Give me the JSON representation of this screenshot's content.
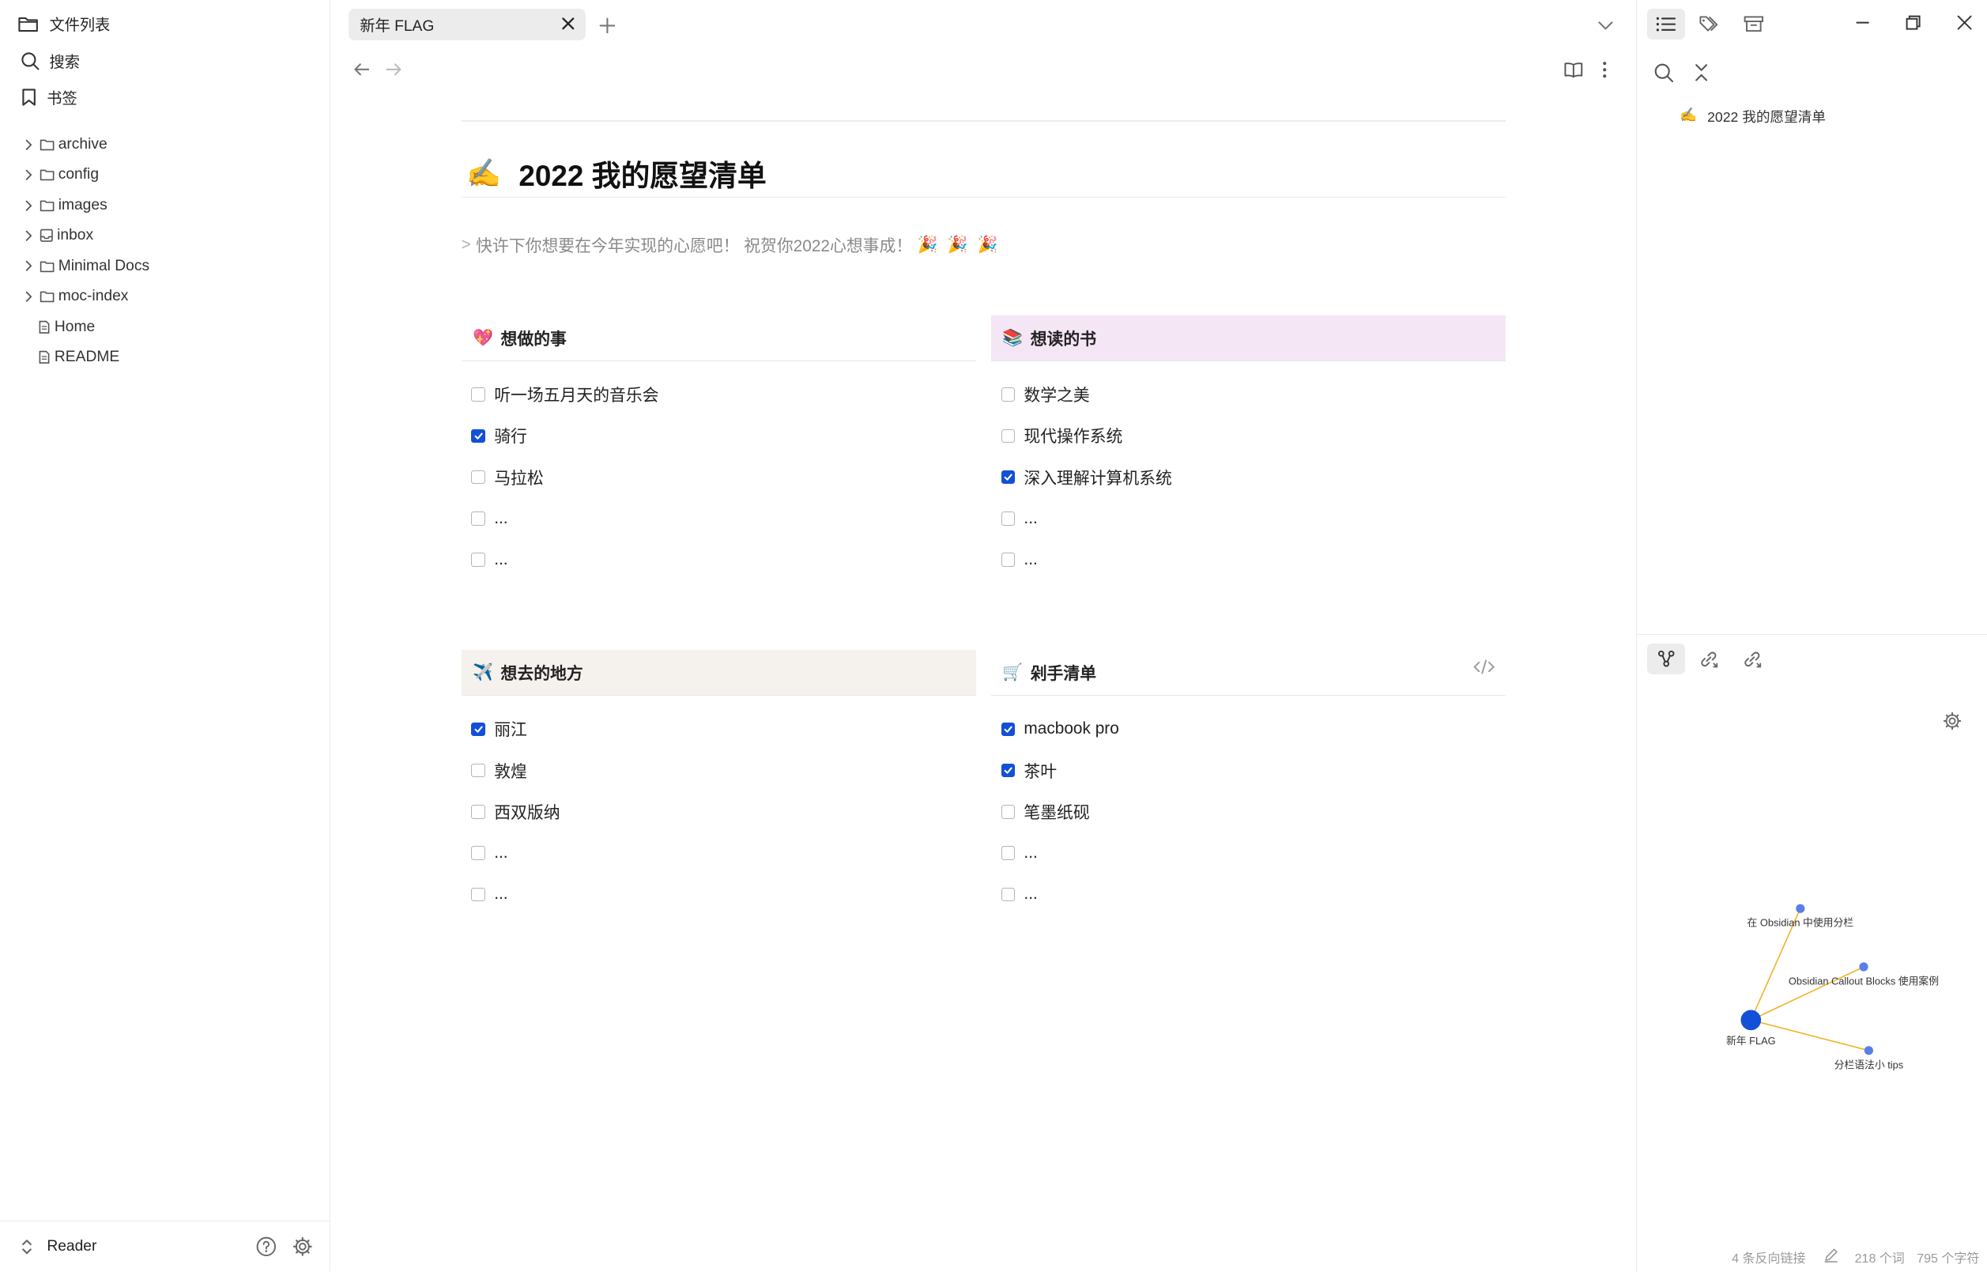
{
  "sidebar": {
    "file_list_label": "文件列表",
    "search_label": "搜索",
    "bookmarks_label": "书签",
    "folders": [
      {
        "name": "archive",
        "icon": "folder-icon"
      },
      {
        "name": "config",
        "icon": "folder-icon"
      },
      {
        "name": "images",
        "icon": "folder-icon"
      },
      {
        "name": "inbox",
        "icon": "inbox-icon"
      },
      {
        "name": "Minimal Docs",
        "icon": "folder-icon"
      },
      {
        "name": "moc-index",
        "icon": "folder-icon"
      }
    ],
    "files": [
      {
        "name": "Home"
      },
      {
        "name": "README"
      }
    ],
    "vault_name": "Reader"
  },
  "tabs": [
    {
      "label": "新年 FLAG",
      "active": true
    }
  ],
  "document": {
    "title_emoji": "✍️",
    "title": "2022 我的愿望清单",
    "quote_marker": ">",
    "quote_text": "快许下你想要在今年实现的心愿吧！ 祝贺你2022心想事成！",
    "quote_emojis": "🎉 🎉 🎉",
    "columns": [
      {
        "emoji": "💖",
        "title": "想做的事",
        "header_bg": "#ffffff",
        "items": [
          {
            "text": "听一场五月天的音乐会",
            "checked": false
          },
          {
            "text": "骑行",
            "checked": true
          },
          {
            "text": "马拉松",
            "checked": false
          },
          {
            "text": "...",
            "checked": false
          },
          {
            "text": "...",
            "checked": false
          }
        ]
      },
      {
        "emoji": "📚",
        "title": "想读的书",
        "header_bg": "#f5e6f5",
        "items": [
          {
            "text": "数学之美",
            "checked": false
          },
          {
            "text": "现代操作系统",
            "checked": false
          },
          {
            "text": "深入理解计算机系统",
            "checked": true
          },
          {
            "text": "...",
            "checked": false
          },
          {
            "text": "...",
            "checked": false
          }
        ]
      },
      {
        "emoji": "✈️",
        "title": "想去的地方",
        "header_bg": "#f5f1ec",
        "items": [
          {
            "text": "丽江",
            "checked": true
          },
          {
            "text": "敦煌",
            "checked": false
          },
          {
            "text": "西双版纳",
            "checked": false
          },
          {
            "text": "...",
            "checked": false
          },
          {
            "text": "...",
            "checked": false
          }
        ]
      },
      {
        "emoji": "🛒",
        "title": "剁手清单",
        "header_bg": "#ffffff",
        "items": [
          {
            "text": "macbook pro",
            "checked": true
          },
          {
            "text": "茶叶",
            "checked": true
          },
          {
            "text": "笔墨纸砚",
            "checked": false
          },
          {
            "text": "...",
            "checked": false
          },
          {
            "text": "...",
            "checked": false
          }
        ]
      }
    ]
  },
  "outline": {
    "items": [
      {
        "emoji": "✍️",
        "text": "2022 我的愿望清单"
      }
    ]
  },
  "graph": {
    "nodes": [
      {
        "id": "current",
        "label": "新年 FLAG"
      },
      {
        "id": "n1",
        "label": "在 Obsidian 中使用分栏"
      },
      {
        "id": "n2",
        "label": "Obsidian Callout Blocks 使用案例"
      },
      {
        "id": "n3",
        "label": "分栏语法小 tips"
      }
    ],
    "link_color": "#f0b429",
    "node_color": "#5b7fe8",
    "current_node_color": "#1250d8"
  },
  "status_bar": {
    "backlinks": "4 条反向链接",
    "words": "218 个词",
    "chars": "795 个字符"
  },
  "colors": {
    "accent": "#1250d8",
    "checkbox_border": "#b5b5b5"
  }
}
